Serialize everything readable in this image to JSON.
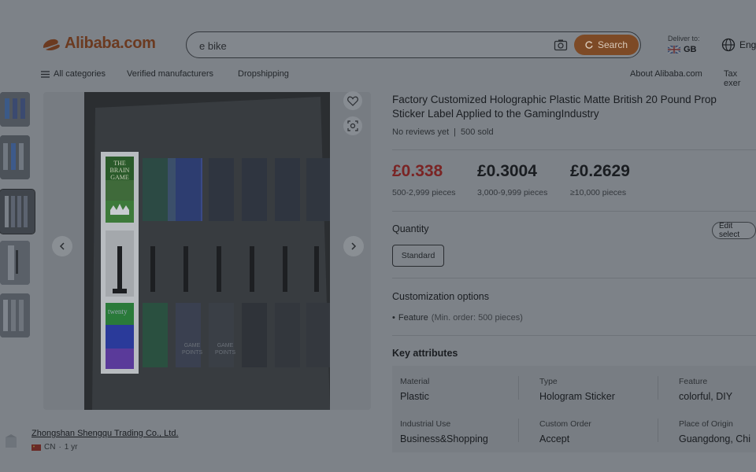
{
  "header": {
    "logo_text": "Alibaba.com",
    "search": {
      "value": "e bike",
      "placeholder": "e bike",
      "button_label": "Search"
    },
    "deliver": {
      "label": "Deliver to:",
      "country": "GB"
    },
    "language": "Eng"
  },
  "nav": {
    "all_categories": "All categories",
    "verified": "Verified manufacturers",
    "dropshipping": "Dropshipping",
    "about": "About Alibaba.com",
    "tax": "Tax exer"
  },
  "product": {
    "title_line1": "Factory Customized Holographic Plastic Matte British 20 Pound Prop",
    "title_line2": "Sticker Label Applied to the GamingIndustry",
    "reviews": "No reviews yet",
    "sold": "500 sold",
    "prices": [
      {
        "price": "£0.338",
        "tier": "500-2,999 pieces"
      },
      {
        "price": "£0.3004",
        "tier": "3,000-9,999 pieces"
      },
      {
        "price": "£0.2629",
        "tier": "≥10,000 pieces"
      }
    ],
    "quantity_label": "Quantity",
    "edit_label": "Edit select",
    "option_standard": "Standard",
    "customization_title": "Customization options",
    "feature_name": "Feature",
    "feature_note": "(Min. order: 500 pieces)",
    "key_attributes_title": "Key attributes",
    "attributes": [
      {
        "k": "Material",
        "v": "Plastic"
      },
      {
        "k": "Type",
        "v": "Hologram Sticker"
      },
      {
        "k": "Feature",
        "v": "colorful, DIY"
      },
      {
        "k": "Industrial Use",
        "v": "Business&Shopping"
      },
      {
        "k": "Custom Order",
        "v": "Accept"
      },
      {
        "k": "Place of Origin",
        "v": "Guangdong, Chi"
      }
    ]
  },
  "image_text": {
    "line1": "THE",
    "line2": "BRAIN",
    "line3": "GAME",
    "twenty": "twenty",
    "game_points": "GAME POINTS"
  },
  "supplier": {
    "name": "Zhongshan Shengqu Trading Co., Ltd.",
    "country": "CN",
    "years": "1 yr"
  },
  "colors": {
    "accent": "#7d4a26",
    "price_red": "#7a2424"
  }
}
